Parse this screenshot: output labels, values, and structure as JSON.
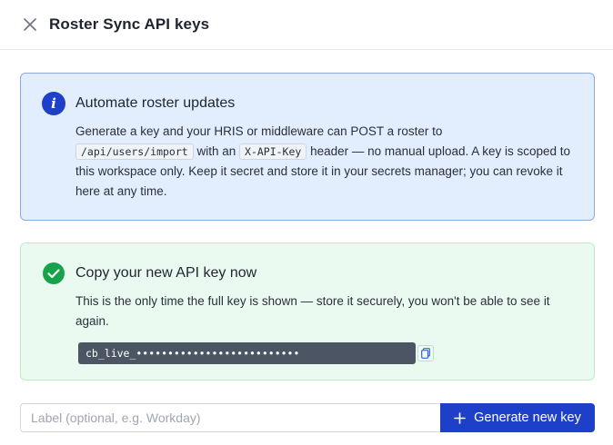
{
  "header": {
    "title": "Roster Sync API keys",
    "close_icon": "close-icon"
  },
  "info_box": {
    "icon": "info-icon",
    "heading": "Automate roster updates",
    "body_part1": "Generate a key and your HRIS or middleware can POST a roster to",
    "endpoint": "/api/users/import",
    "body_part2": "with an",
    "header_name": "X-API-Key",
    "body_part3": "header — no manual upload. A key is scoped to this workspace only. Keep it secret and store it in your secrets manager; you can revoke it here at any time."
  },
  "success_box": {
    "icon": "check-circle-icon",
    "heading": "Copy your new API key now",
    "body": "This is the only time the full key is shown — store it securely, you won't be able to see it again.",
    "key_value": "cb_live_••••••••••••••••••••••••••",
    "copy_icon": "copy-icon"
  },
  "form": {
    "label_placeholder": "Label (optional, e.g. Workday)",
    "label_value": "",
    "generate_label": "Generate new key",
    "generate_icon": "plus-icon"
  },
  "colors": {
    "primary": "#1e40c8",
    "info_bg": "#e2edfd",
    "info_border": "#8aacdf",
    "success_bg": "#ebfaf0",
    "success_border": "#bfe9cc",
    "success_icon": "#16a34a",
    "key_bg": "#4b5563"
  }
}
